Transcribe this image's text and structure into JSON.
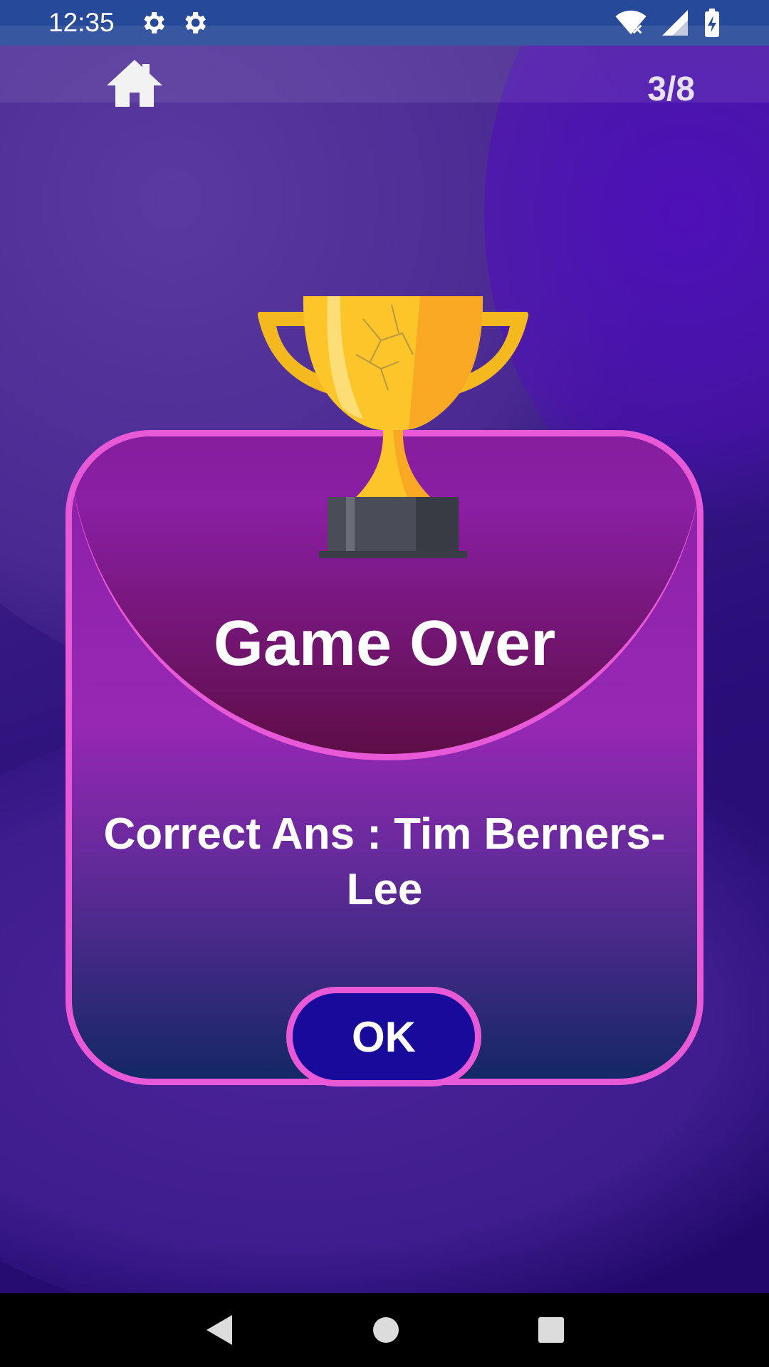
{
  "status_bar": {
    "time": "12:35",
    "icons": [
      "settings-gear-icon",
      "settings-gear-icon",
      "wifi-icon",
      "signal-icon",
      "battery-charging-icon"
    ]
  },
  "top_bar": {
    "home_icon": "home-icon",
    "progress": "3/8"
  },
  "dialog": {
    "title": "Game Over",
    "answer": "Correct Ans : Tim Berners-Lee",
    "ok_label": "OK",
    "image": "trophy-icon"
  },
  "nav_bar": {
    "icons": [
      "back-icon",
      "home-circle-icon",
      "recents-icon"
    ]
  },
  "colors": {
    "accent_pink": "#e859d8",
    "button_blue": "#180a9a",
    "status_bar": "#26499a"
  }
}
